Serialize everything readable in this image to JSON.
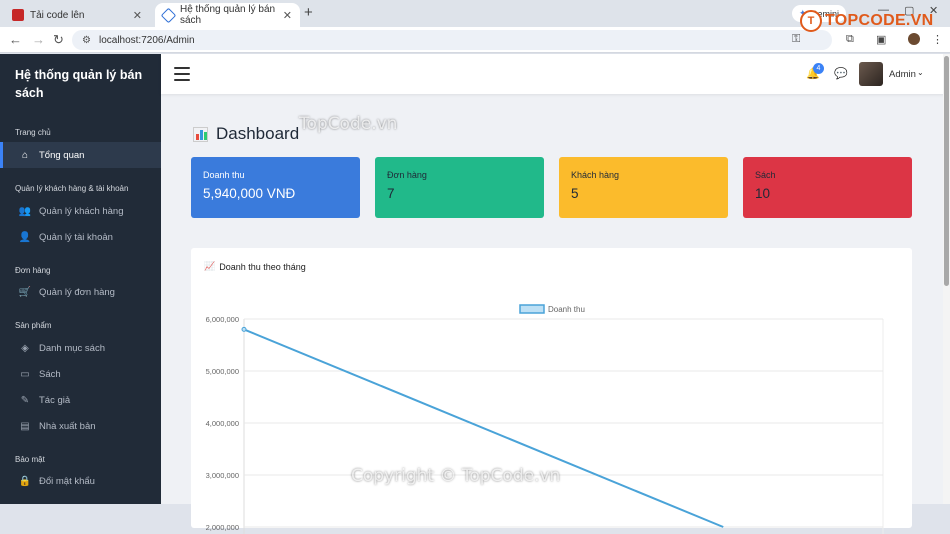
{
  "browser": {
    "tabs": [
      {
        "title": "Tải code lên",
        "active": false
      },
      {
        "title": "Hệ thống quản lý bán sách",
        "active": true
      }
    ],
    "new_tab": "+",
    "close": "✕",
    "gemini": "Gemini",
    "url": "localhost:7206/Admin",
    "window_controls": [
      "—",
      "▢",
      "✕"
    ]
  },
  "watermark_logo": {
    "text": "TOPCODE.VN",
    "mark": "T"
  },
  "sidebar": {
    "brand": "Hệ thống quản lý bán sách",
    "sections": [
      {
        "title": "Trang chủ",
        "items": [
          {
            "label": "Tổng quan",
            "icon": "home-icon",
            "active": true
          }
        ]
      },
      {
        "title": "Quản lý khách hàng & tài khoản",
        "items": [
          {
            "label": "Quản lý khách hàng",
            "icon": "users-icon"
          },
          {
            "label": "Quản lý tài khoản",
            "icon": "user-check-icon"
          }
        ]
      },
      {
        "title": "Đơn hàng",
        "items": [
          {
            "label": "Quản lý đơn hàng",
            "icon": "cart-icon"
          }
        ]
      },
      {
        "title": "Sản phẩm",
        "items": [
          {
            "label": "Danh mục sách",
            "icon": "layers-icon"
          },
          {
            "label": "Sách",
            "icon": "book-icon"
          },
          {
            "label": "Tác giả",
            "icon": "pen-icon"
          },
          {
            "label": "Nhà xuất bản",
            "icon": "briefcase-icon"
          }
        ]
      },
      {
        "title": "Bảo mật",
        "items": [
          {
            "label": "Đổi mật khẩu",
            "icon": "lock-icon"
          }
        ]
      }
    ]
  },
  "header": {
    "notification_count": "4",
    "user": "Admin"
  },
  "page": {
    "title": "Dashboard"
  },
  "stats": [
    {
      "label": "Doanh thu",
      "value": "5,940,000 VNĐ",
      "color": "#3a7bdc"
    },
    {
      "label": "Đơn hàng",
      "value": "7",
      "color": "#21b98a"
    },
    {
      "label": "Khách hàng",
      "value": "5",
      "color": "#fbbb2c"
    },
    {
      "label": "Sách",
      "value": "10",
      "color": "#dc3545"
    }
  ],
  "chart_data": {
    "type": "line",
    "title": "Doanh thu theo tháng",
    "legend": "top-center",
    "series": [
      {
        "name": "Doanh thu",
        "color": "#4aa3d8",
        "points": [
          [
            0,
            5800000
          ],
          [
            0.75,
            2000000
          ]
        ]
      }
    ],
    "yticks": [
      "6,000,000",
      "5,000,000",
      "4,000,000",
      "3,000,000",
      "2,000,000"
    ],
    "ylim": [
      2000000,
      6000000
    ],
    "grid": true
  },
  "watermarks": [
    "TopCode.vn",
    "Copyright © TopCode.vn"
  ]
}
